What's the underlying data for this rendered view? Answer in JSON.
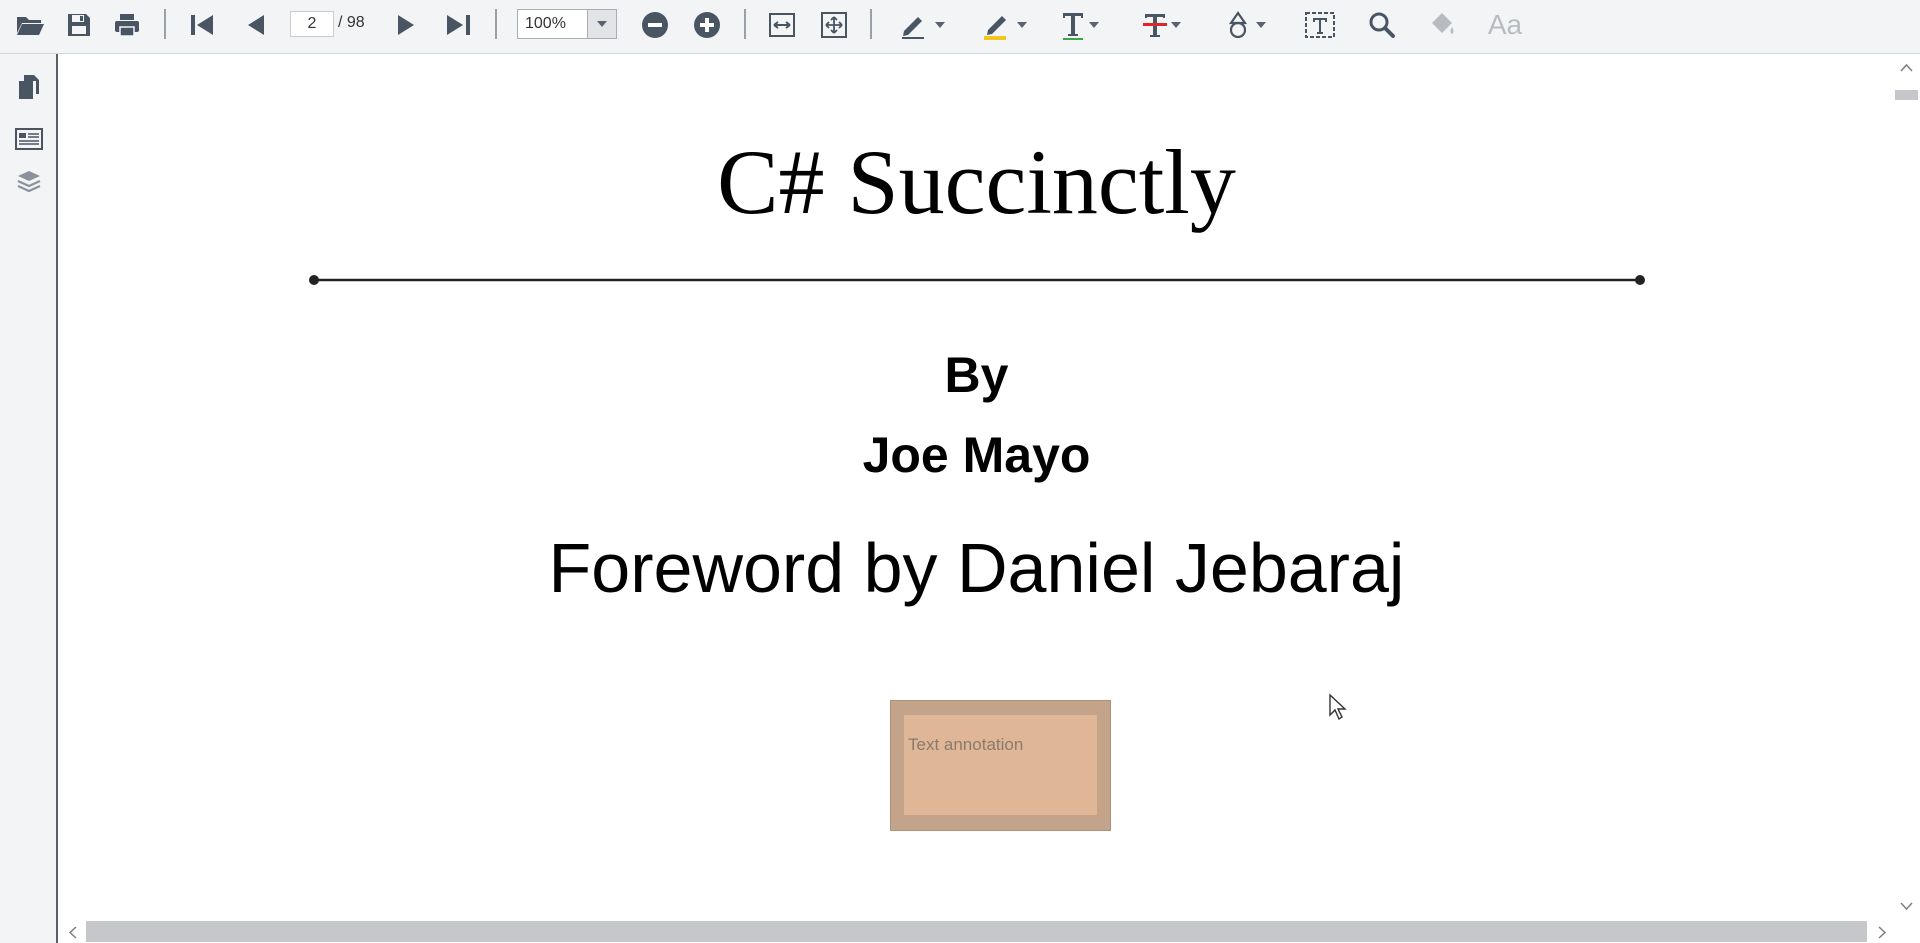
{
  "toolbar": {
    "page_number": "2",
    "page_total": "/ 98",
    "zoom_value": "100%",
    "font_label": "Aa"
  },
  "document": {
    "title": "C# Succinctly",
    "by": "By",
    "author": "Joe Mayo",
    "foreword": "Foreword by Daniel Jebaraj",
    "annotation_text": "Text annotation"
  },
  "colors": {
    "icon": "#4a5563",
    "ink_underline": "#f2c61f",
    "text_tool_underline": "#3aa64a",
    "strike_red": "#e0242a",
    "annotation_fill": "#dfb797",
    "annotation_border": "#c3a48b"
  },
  "icons": {
    "open": "folder-open-icon",
    "save": "save-icon",
    "print": "print-icon",
    "first": "first-page-icon",
    "prev": "previous-page-icon",
    "next": "next-page-icon",
    "last": "last-page-icon",
    "zoom_out": "zoom-out-icon",
    "zoom_in": "zoom-in-icon",
    "fit_width": "fit-width-icon",
    "fit_page": "fit-page-icon",
    "ink": "ink-pen-icon",
    "highlight": "highlight-pen-icon",
    "text_markup": "text-markup-icon",
    "strikethrough": "strikethrough-icon",
    "shapes": "shapes-icon",
    "free_text": "free-text-icon",
    "search": "search-icon",
    "fill": "fill-color-icon",
    "font": "font-icon"
  }
}
